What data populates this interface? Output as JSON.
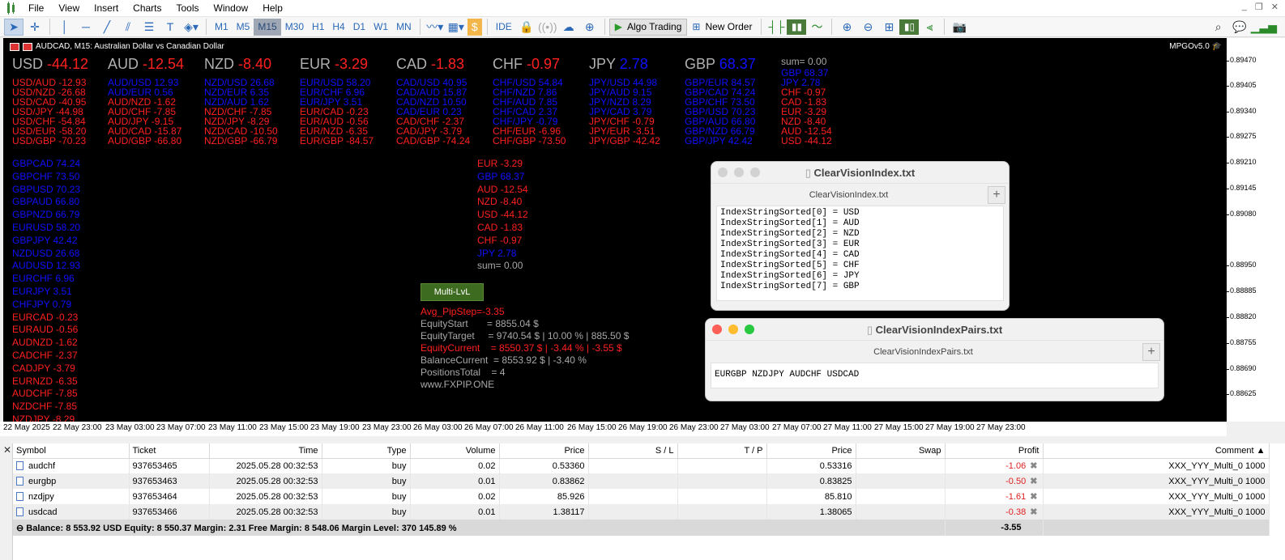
{
  "menubar": {
    "items": [
      "File",
      "View",
      "Insert",
      "Charts",
      "Tools",
      "Window",
      "Help"
    ]
  },
  "toolbar": {
    "timeframes": [
      "M1",
      "M5",
      "M15",
      "M30",
      "H1",
      "H4",
      "D1",
      "W1",
      "MN"
    ],
    "active_timeframe": "M15",
    "ide_label": "IDE",
    "algo_trading_label": "Algo Trading",
    "new_order_label": "New Order"
  },
  "chart": {
    "title": "AUDCAD, M15:  Australian Dollar vs Canadian Dollar",
    "indicator_label": "MPGOv5.0",
    "price_ticks": [
      "0.89470",
      "0.89405",
      "0.89340",
      "0.89275",
      "0.89210",
      "0.89145",
      "0.89080",
      "0.88950",
      "0.88885",
      "0.88820",
      "0.88755",
      "0.88690",
      "0.88625"
    ],
    "time_ticks": [
      "22 May 2025",
      "22 May 23:00",
      "23 May 03:00",
      "23 May 07:00",
      "23 May 11:00",
      "23 May 15:00",
      "23 May 19:00",
      "23 May 23:00",
      "26 May 03:00",
      "26 May 07:00",
      "26 May 11:00",
      "26 May 15:00",
      "26 May 19:00",
      "26 May 23:00",
      "27 May 03:00",
      "27 May 07:00",
      "27 May 11:00",
      "27 May 15:00",
      "27 May 19:00",
      "27 May 23:00"
    ],
    "currencies": [
      {
        "name": "USD",
        "value": "-44.12",
        "color": "red",
        "pairs": [
          [
            "USD/AUD -12.93",
            "red"
          ],
          [
            "USD/NZD -26.68",
            "red"
          ],
          [
            "USD/CAD -40.95",
            "red"
          ],
          [
            "USD/JPY -44.98",
            "red"
          ],
          [
            "USD/CHF -54.84",
            "red"
          ],
          [
            "USD/EUR -58.20",
            "red"
          ],
          [
            "USD/GBP -70.23",
            "red"
          ]
        ]
      },
      {
        "name": "AUD",
        "value": "-12.54",
        "color": "red",
        "pairs": [
          [
            "AUD/USD 12.93",
            "blue"
          ],
          [
            "AUD/EUR 0.56",
            "blue"
          ],
          [
            "AUD/NZD -1.62",
            "red"
          ],
          [
            "AUD/CHF -7.85",
            "red"
          ],
          [
            "AUD/JPY -9.15",
            "red"
          ],
          [
            "AUD/CAD -15.87",
            "red"
          ],
          [
            "AUD/GBP -66.80",
            "red"
          ]
        ]
      },
      {
        "name": "NZD",
        "value": "-8.40",
        "color": "red",
        "pairs": [
          [
            "NZD/USD 26.68",
            "blue"
          ],
          [
            "NZD/EUR 6.35",
            "blue"
          ],
          [
            "NZD/AUD 1.62",
            "blue"
          ],
          [
            "NZD/CHF -7.85",
            "red"
          ],
          [
            "NZD/JPY -8.29",
            "red"
          ],
          [
            "NZD/CAD -10.50",
            "red"
          ],
          [
            "NZD/GBP -66.79",
            "red"
          ]
        ]
      },
      {
        "name": "EUR",
        "value": "-3.29",
        "color": "red",
        "pairs": [
          [
            "EUR/USD 58.20",
            "blue"
          ],
          [
            "EUR/CHF 6.96",
            "blue"
          ],
          [
            "EUR/JPY 3.51",
            "blue"
          ],
          [
            "EUR/CAD -0.23",
            "red"
          ],
          [
            "EUR/AUD -0.56",
            "red"
          ],
          [
            "EUR/NZD -6.35",
            "red"
          ],
          [
            "EUR/GBP -84.57",
            "red"
          ]
        ]
      },
      {
        "name": "CAD",
        "value": "-1.83",
        "color": "red",
        "pairs": [
          [
            "CAD/USD 40.95",
            "blue"
          ],
          [
            "CAD/AUD 15.87",
            "blue"
          ],
          [
            "CAD/NZD 10.50",
            "blue"
          ],
          [
            "CAD/EUR 0.23",
            "blue"
          ],
          [
            "CAD/CHF -2.37",
            "red"
          ],
          [
            "CAD/JPY -3.79",
            "red"
          ],
          [
            "CAD/GBP -74.24",
            "red"
          ]
        ]
      },
      {
        "name": "CHF",
        "value": "-0.97",
        "color": "red",
        "pairs": [
          [
            "CHF/USD 54.84",
            "blue"
          ],
          [
            "CHF/NZD 7.86",
            "blue"
          ],
          [
            "CHF/AUD 7.85",
            "blue"
          ],
          [
            "CHF/CAD 2.37",
            "blue"
          ],
          [
            "CHF/JPY -0.79",
            "blue"
          ],
          [
            "CHF/EUR -6.96",
            "red"
          ],
          [
            "CHF/GBP -73.50",
            "red"
          ]
        ]
      },
      {
        "name": "JPY",
        "value": "2.78",
        "color": "blue",
        "pairs": [
          [
            "JPY/USD 44.98",
            "blue"
          ],
          [
            "JPY/AUD 9.15",
            "blue"
          ],
          [
            "JPY/NZD 8.29",
            "blue"
          ],
          [
            "JPY/CAD 3.79",
            "blue"
          ],
          [
            "JPY/CHF -0.79",
            "red"
          ],
          [
            "JPY/EUR -3.51",
            "red"
          ],
          [
            "JPY/GBP -42.42",
            "red"
          ]
        ]
      },
      {
        "name": "GBP",
        "value": "68.37",
        "color": "blue",
        "pairs": [
          [
            "GBP/EUR 84.57",
            "blue"
          ],
          [
            "GBP/CAD 74.24",
            "blue"
          ],
          [
            "GBP/CHF 73.50",
            "blue"
          ],
          [
            "GBP/USD 70.23",
            "blue"
          ],
          [
            "GBP/AUD 66.80",
            "blue"
          ],
          [
            "GBP/NZD 66.79",
            "blue"
          ],
          [
            "GBP/JPY 42.42",
            "blue"
          ]
        ]
      }
    ],
    "sum_label": "sum= 0.00",
    "sorted_column": [
      [
        "GBP 68.37",
        "blue"
      ],
      [
        "JPY 2.78",
        "blue"
      ],
      [
        "CHF -0.97",
        "red"
      ],
      [
        "CAD -1.83",
        "red"
      ],
      [
        "EUR -3.29",
        "red"
      ],
      [
        "NZD -8.40",
        "red"
      ],
      [
        "AUD -12.54",
        "red"
      ],
      [
        "USD -44.12",
        "red"
      ]
    ],
    "pair_list": [
      [
        "GBPCAD 74.24",
        "blue"
      ],
      [
        "GBPCHF 73.50",
        "blue"
      ],
      [
        "GBPUSD 70.23",
        "blue"
      ],
      [
        "GBPAUD 66.80",
        "blue"
      ],
      [
        "GBPNZD 66.79",
        "blue"
      ],
      [
        "EURUSD 58.20",
        "blue"
      ],
      [
        "GBPJPY 42.42",
        "blue"
      ],
      [
        "NZDUSD 26.68",
        "blue"
      ],
      [
        "AUDUSD 12.93",
        "blue"
      ],
      [
        "EURCHF 6.96",
        "blue"
      ],
      [
        "EURJPY 3.51",
        "blue"
      ],
      [
        "CHFJPY 0.79",
        "blue"
      ],
      [
        "EURCAD -0.23",
        "red"
      ],
      [
        "EURAUD -0.56",
        "red"
      ],
      [
        "AUDNZD -1.62",
        "red"
      ],
      [
        "CADCHF -2.37",
        "red"
      ],
      [
        "CADJPY -3.79",
        "red"
      ],
      [
        "EURNZD -6.35",
        "red"
      ],
      [
        "AUDCHF -7.85",
        "red"
      ],
      [
        "NZDCHF -7.85",
        "red"
      ],
      [
        "NZDJPY -8.29",
        "red"
      ]
    ],
    "mid_list": [
      [
        "EUR -3.29",
        "red"
      ],
      [
        "GBP 68.37",
        "blue"
      ],
      [
        "AUD -12.54",
        "red"
      ],
      [
        "NZD -8.40",
        "red"
      ],
      [
        "USD -44.12",
        "red"
      ],
      [
        "CAD -1.83",
        "red"
      ],
      [
        "CHF -0.97",
        "red"
      ],
      [
        "JPY 2.78",
        "blue"
      ],
      [
        "sum= 0.00",
        "gray"
      ]
    ],
    "multi_button_label": "Multi-LvL",
    "stats": [
      [
        "Avg_PipStep=-3.35",
        "red"
      ],
      [
        "EquityStart       = 8855.04 $",
        "gray"
      ],
      [
        "EquityTarget     = 9740.54 $ | 10.00 % | 885.50 $",
        "gray"
      ],
      [
        "EquityCurrent    = 8550.37 $ | -3.44 % | -3.55 $",
        "red"
      ],
      [
        "BalanceCurrent  = 8553.92 $ | -3.40 %",
        "gray"
      ],
      [
        "PositionsTotal    = 4",
        "gray"
      ],
      [
        "www.FXPIP.ONE",
        "gray"
      ]
    ]
  },
  "window_index": {
    "title": "ClearVisionIndex.txt",
    "tab": "ClearVisionIndex.txt",
    "lines": [
      "IndexStringSorted[0] = USD",
      "IndexStringSorted[1] = AUD",
      "IndexStringSorted[2] = NZD",
      "IndexStringSorted[3] = EUR",
      "IndexStringSorted[4] = CAD",
      "IndexStringSorted[5] = CHF",
      "IndexStringSorted[6] = JPY",
      "IndexStringSorted[7] = GBP"
    ]
  },
  "window_pairs": {
    "title": "ClearVisionIndexPairs.txt",
    "tab": "ClearVisionIndexPairs.txt",
    "lines": [
      "EURGBP NZDJPY AUDCHF USDCAD"
    ]
  },
  "terminal": {
    "columns": [
      "Symbol",
      "Ticket",
      "Time",
      "Type",
      "Volume",
      "Price",
      "S / L",
      "T / P",
      "Price",
      "Swap",
      "Profit",
      "Comment"
    ],
    "rows": [
      {
        "symbol": "audchf",
        "ticket": "937653465",
        "time": "2025.05.28 00:32:53",
        "type": "buy",
        "volume": "0.02",
        "price": "0.53360",
        "sl": "",
        "tp": "",
        "cur_price": "0.53316",
        "swap": "",
        "profit": "-1.06",
        "comment": "XXX_YYY_Multi_0 1000"
      },
      {
        "symbol": "eurgbp",
        "ticket": "937653463",
        "time": "2025.05.28 00:32:53",
        "type": "buy",
        "volume": "0.01",
        "price": "0.83862",
        "sl": "",
        "tp": "",
        "cur_price": "0.83825",
        "swap": "",
        "profit": "-0.50",
        "comment": "XXX_YYY_Multi_0 1000"
      },
      {
        "symbol": "nzdjpy",
        "ticket": "937653464",
        "time": "2025.05.28 00:32:53",
        "type": "buy",
        "volume": "0.02",
        "price": "85.926",
        "sl": "",
        "tp": "",
        "cur_price": "85.810",
        "swap": "",
        "profit": "-1.61",
        "comment": "XXX_YYY_Multi_0 1000"
      },
      {
        "symbol": "usdcad",
        "ticket": "937653466",
        "time": "2025.05.28 00:32:53",
        "type": "buy",
        "volume": "0.01",
        "price": "1.38117",
        "sl": "",
        "tp": "",
        "cur_price": "1.38065",
        "swap": "",
        "profit": "-0.38",
        "comment": "XXX_YYY_Multi_0 1000"
      }
    ],
    "summary": "Balance: 8 553.92 USD  Equity: 8 550.37  Margin: 2.31  Free Margin: 8 548.06  Margin Level: 370 145.89 %",
    "summary_profit": "-3.55"
  }
}
